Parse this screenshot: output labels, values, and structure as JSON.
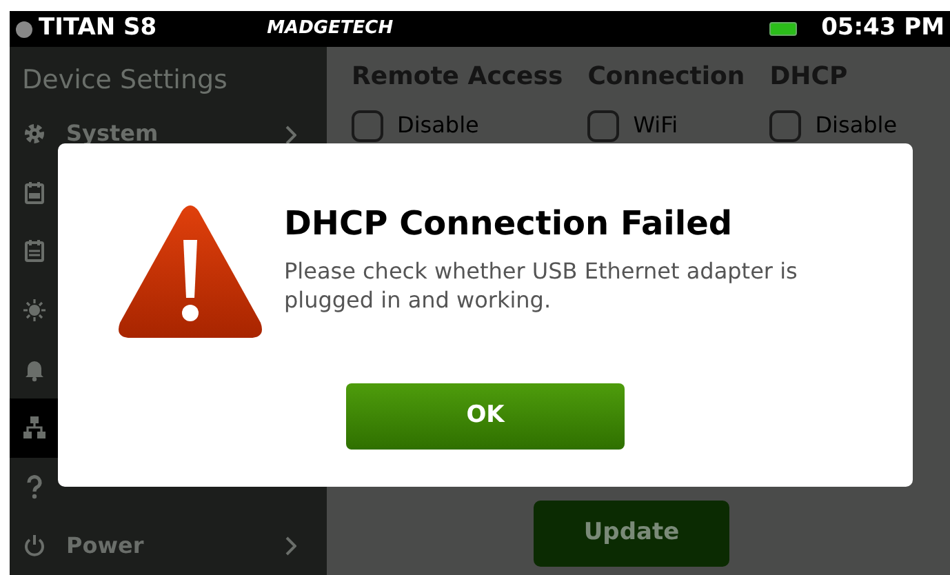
{
  "status_bar": {
    "device": "TITAN S8",
    "brand": "MADGETECH",
    "time": "05:43 PM"
  },
  "sidebar": {
    "title": "Device Settings",
    "items": [
      {
        "label": "System",
        "selected": false
      },
      {
        "selected": false
      },
      {
        "selected": false
      },
      {
        "selected": false
      },
      {
        "selected": false
      },
      {
        "selected": true
      },
      {
        "selected": false
      },
      {
        "label": "Power",
        "selected": false
      }
    ]
  },
  "settings": {
    "columns": [
      {
        "heading": "Remote Access",
        "option": "Disable",
        "checked": false
      },
      {
        "heading": "Connection",
        "option": "WiFi",
        "checked": false
      },
      {
        "heading": "DHCP",
        "option": "Disable",
        "checked": false
      }
    ],
    "update_button": "Update"
  },
  "dialog": {
    "title": "DHCP Connection Failed",
    "message": "Please check whether USB Ethernet adapter is plugged in and working.",
    "button": "OK"
  }
}
